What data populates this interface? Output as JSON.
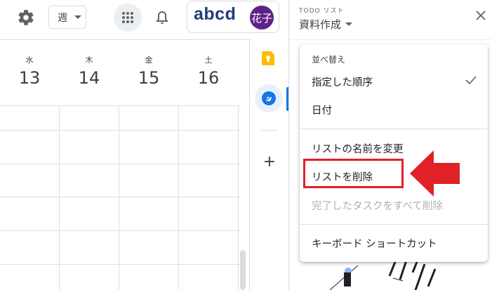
{
  "header": {
    "view_select": "週",
    "brand": "abcd",
    "avatar_text": "花子"
  },
  "calendar": {
    "days": [
      {
        "name": "水",
        "num": "13"
      },
      {
        "name": "木",
        "num": "14"
      },
      {
        "name": "金",
        "num": "15"
      },
      {
        "name": "土",
        "num": "16"
      }
    ]
  },
  "tasks_panel": {
    "label": "TODO リスト",
    "list_name": "資料作成",
    "menu": {
      "section_label": "並べ替え",
      "items": [
        {
          "label": "指定した順序",
          "checked": true
        },
        {
          "label": "日付"
        },
        {
          "label": "リストの名前を変更"
        },
        {
          "label": "リストを削除"
        },
        {
          "label": "完了したタスクをすべて削除",
          "disabled": true
        },
        {
          "label": "キーボード ショートカット"
        }
      ]
    }
  },
  "colors": {
    "accent": "#1a73e8",
    "highlight": "#e02128",
    "avatar_bg": "#5e2185",
    "brand": "#1f3d7a"
  }
}
